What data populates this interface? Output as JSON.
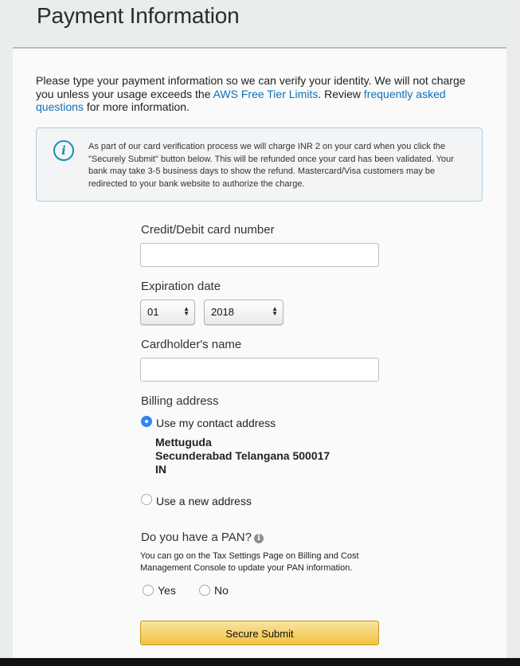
{
  "page": {
    "title": "Payment Information"
  },
  "intro": {
    "text_before_link1": "Please type your payment information so we can verify your identity. We will not charge you unless your usage exceeds the ",
    "link1": "AWS Free Tier Limits",
    "text_between": ". Review ",
    "link2": "frequently asked questions",
    "text_after": " for more information."
  },
  "notice": {
    "icon": "info-icon",
    "text": "As part of our card verification process we will charge INR 2 on your card when you click the \"Securely Submit\" button below. This will be refunded once your card has been validated. Your bank may take 3-5 business days to show the refund. Mastercard/Visa customers may be redirected to your bank website to authorize the charge."
  },
  "form": {
    "card_number": {
      "label": "Credit/Debit card number",
      "value": ""
    },
    "expiration": {
      "label": "Expiration date",
      "month": "01",
      "year": "2018"
    },
    "cardholder": {
      "label": "Cardholder's name",
      "value": ""
    },
    "billing": {
      "label": "Billing address",
      "option_contact": "Use my contact address",
      "option_contact_selected": true,
      "address_lines": [
        "Mettuguda",
        "Secunderabad Telangana 500017",
        "IN"
      ],
      "option_new": "Use a new address"
    },
    "pan": {
      "label": "Do you have a PAN?",
      "info_icon": "info-circle-icon",
      "note": "You can go on the Tax Settings Page on Billing and Cost Management Console to update your PAN information.",
      "yes": "Yes",
      "no": "No"
    },
    "submit_label": "Secure Submit"
  }
}
